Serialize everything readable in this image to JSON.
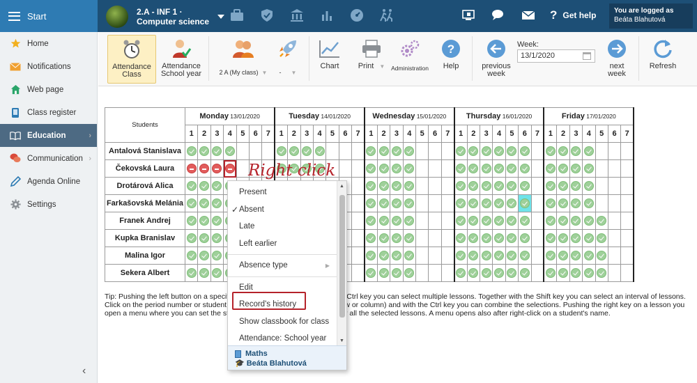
{
  "topbar": {
    "start_label": "Start",
    "class_line1": "2.A - INF 1 ·",
    "class_line2": "Computer science",
    "icons": [
      "briefcase-icon",
      "shield-icon",
      "bank-icon",
      "chart-icon",
      "gauge-icon",
      "running-icon"
    ],
    "right_icons": [
      "monitor-icon",
      "chat-icon",
      "mail-icon"
    ],
    "help_label": "Get help",
    "logged_label": "You are logged as",
    "logged_user": "Beáta Blahutová"
  },
  "sidebar": {
    "items": [
      {
        "label": "Home",
        "icon": "star-icon"
      },
      {
        "label": "Notifications",
        "icon": "envelope-icon"
      },
      {
        "label": "Web page",
        "icon": "house-icon"
      },
      {
        "label": "Class register",
        "icon": "phone-icon"
      },
      {
        "label": "Education",
        "icon": "book-icon"
      },
      {
        "label": "Communication",
        "icon": "chat-icon"
      },
      {
        "label": "Agenda Online",
        "icon": "pen-icon"
      },
      {
        "label": "Settings",
        "icon": "gear-icon"
      }
    ]
  },
  "toolbar": {
    "att_class": "Attendance Class",
    "att_class_l1": "Attendance",
    "att_class_l2": "Class",
    "att_year_l1": "Attendance",
    "att_year_l2": "School year",
    "my_class": "2 A (My class)",
    "dash": "-",
    "chart": "Chart",
    "print": "Print",
    "admin": "Administration",
    "help": "Help",
    "prev_l1": "previous",
    "prev_l2": "week",
    "week_label": "Week:",
    "week_value": "13/1/2020",
    "next_l1": "next",
    "next_l2": "week",
    "refresh": "Refresh"
  },
  "table": {
    "students_header": "Students",
    "days": [
      {
        "name": "Monday",
        "date": "13/01/2020"
      },
      {
        "name": "Tuesday",
        "date": "14/01/2020"
      },
      {
        "name": "Wednesday",
        "date": "15/01/2020"
      },
      {
        "name": "Thursday",
        "date": "16/01/2020"
      },
      {
        "name": "Friday",
        "date": "17/01/2020"
      }
    ],
    "lessons": [
      "1",
      "2",
      "3",
      "4",
      "5",
      "6",
      "7"
    ],
    "students": [
      {
        "name": "Antalová Stanislava",
        "marks": [
          [
            "p",
            "p",
            "p",
            "p",
            "",
            "",
            ""
          ],
          [
            "p",
            "p",
            "p",
            "p",
            "",
            "",
            ""
          ],
          [
            "p",
            "p",
            "p",
            "p",
            "",
            "",
            ""
          ],
          [
            "p",
            "p",
            "p",
            "p",
            "p",
            "p",
            ""
          ],
          [
            "p",
            "p",
            "p",
            "p",
            "",
            "",
            ""
          ]
        ]
      },
      {
        "name": "Čekovská Laura",
        "marks": [
          [
            "a",
            "a",
            "a",
            "a",
            "",
            "",
            ""
          ],
          [
            "p",
            "p",
            "p",
            "p",
            "",
            "",
            ""
          ],
          [
            "p",
            "p",
            "p",
            "p",
            "",
            "",
            ""
          ],
          [
            "p",
            "p",
            "p",
            "p",
            "p",
            "p",
            ""
          ],
          [
            "p",
            "p",
            "p",
            "p",
            "",
            "",
            ""
          ]
        ]
      },
      {
        "name": "Drotárová Alica",
        "marks": [
          [
            "p",
            "p",
            "p",
            "p",
            "",
            "",
            ""
          ],
          [
            "p",
            "p",
            "p",
            "p",
            "",
            "",
            ""
          ],
          [
            "p",
            "p",
            "p",
            "p",
            "",
            "",
            ""
          ],
          [
            "p",
            "p",
            "p",
            "p",
            "p",
            "p",
            ""
          ],
          [
            "p",
            "p",
            "p",
            "p",
            "",
            "",
            ""
          ]
        ]
      },
      {
        "name": "Farkašovská Melánia",
        "marks": [
          [
            "p",
            "p",
            "p",
            "p",
            "",
            "",
            ""
          ],
          [
            "p",
            "p",
            "p",
            "p",
            "",
            "",
            ""
          ],
          [
            "p",
            "p",
            "p",
            "p",
            "",
            "",
            ""
          ],
          [
            "p",
            "p",
            "p",
            "p",
            "p",
            "p",
            ""
          ],
          [
            "p",
            "p",
            "p",
            "p",
            "",
            "",
            ""
          ]
        ]
      },
      {
        "name": "Franek Andrej",
        "marks": [
          [
            "p",
            "p",
            "p",
            "p",
            "",
            "",
            ""
          ],
          [
            "p",
            "p",
            "p",
            "p",
            "",
            "",
            ""
          ],
          [
            "p",
            "p",
            "p",
            "p",
            "",
            "",
            ""
          ],
          [
            "p",
            "p",
            "p",
            "p",
            "p",
            "p",
            ""
          ],
          [
            "p",
            "p",
            "p",
            "p",
            "p",
            "",
            ""
          ]
        ]
      },
      {
        "name": "Kupka Branislav",
        "marks": [
          [
            "p",
            "p",
            "p",
            "p",
            "",
            "",
            ""
          ],
          [
            "p",
            "p",
            "p",
            "p",
            "",
            "",
            ""
          ],
          [
            "p",
            "p",
            "p",
            "p",
            "",
            "",
            ""
          ],
          [
            "p",
            "p",
            "p",
            "p",
            "p",
            "p",
            ""
          ],
          [
            "p",
            "p",
            "p",
            "p",
            "p",
            "",
            ""
          ]
        ]
      },
      {
        "name": "Malina Igor",
        "marks": [
          [
            "p",
            "p",
            "p",
            "p",
            "",
            "",
            ""
          ],
          [
            "p",
            "p",
            "p",
            "p",
            "",
            "",
            ""
          ],
          [
            "p",
            "p",
            "p",
            "p",
            "",
            "",
            ""
          ],
          [
            "p",
            "p",
            "p",
            "p",
            "p",
            "p",
            ""
          ],
          [
            "p",
            "p",
            "p",
            "p",
            "p",
            "",
            ""
          ]
        ]
      },
      {
        "name": "Sekera Albert",
        "marks": [
          [
            "p",
            "p",
            "p",
            "p",
            "",
            "",
            ""
          ],
          [
            "p",
            "p",
            "p",
            "p",
            "",
            "",
            ""
          ],
          [
            "p",
            "p",
            "p",
            "p",
            "",
            "",
            ""
          ],
          [
            "p",
            "p",
            "p",
            "p",
            "p",
            "p",
            ""
          ],
          [
            "p",
            "p",
            "p",
            "p",
            "p",
            "",
            ""
          ]
        ]
      }
    ]
  },
  "tip": "Tip: Pushing the left button on a specific lesson marks it. Together with the Ctrl key you can select multiple lessons. Together with the Shift key you can select an interval of lessons. Click on the period number or student name selects a group of lessons (row or column) and with the Ctrl key you can combine the selections. Pushing the right key on a lesson you open a menu where you can set the students absence and other events for all the selected lessons. A menu opens also after right-click on a student's name.",
  "context_menu": {
    "items": [
      "Present",
      "Absent",
      "Late",
      "Left earlier",
      "Absence type",
      "Edit",
      "Record's history",
      "Show classbook for class",
      "Attendance: School year"
    ],
    "subject": "Maths",
    "teacher": "Beáta Blahutová"
  },
  "annotation": "Right click",
  "colors": {
    "topbar": "#1d4f76",
    "accent": "#2e7bb3",
    "present": "#9fd09a",
    "absent": "#e25c5c",
    "highlight": "#b5222a"
  }
}
